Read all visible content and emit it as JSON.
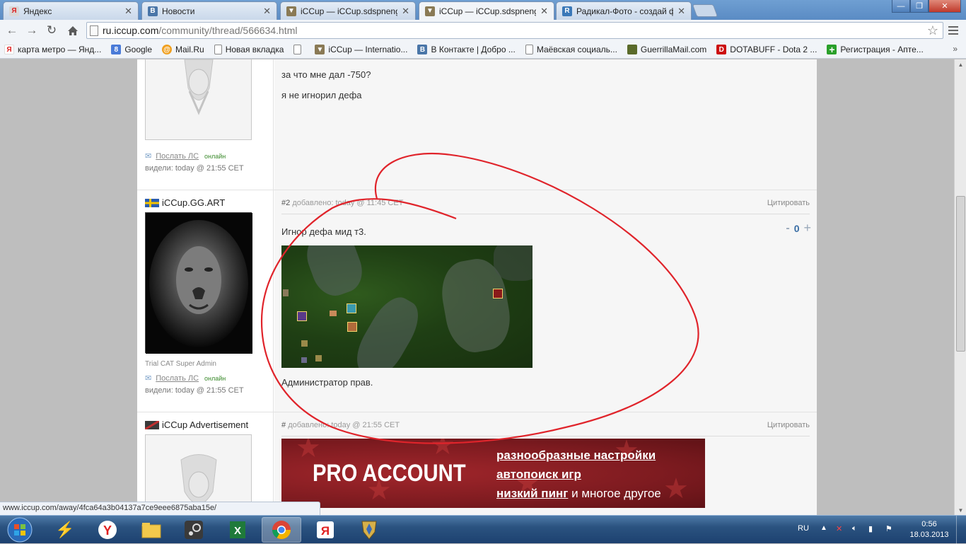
{
  "tabs": [
    {
      "label": "Яндекс",
      "color": "#d8d8d8",
      "icon": "yandex-icon",
      "glyph": "Я"
    },
    {
      "label": "Новости",
      "color": "#4a76a8",
      "icon": "vk-icon",
      "glyph": "В"
    },
    {
      "label": "iCCup — iCCup.sdspneng",
      "color": "#8a7a55",
      "icon": "iccup-icon",
      "glyph": "▼"
    },
    {
      "label": "iCCup — iCCup.sdspneng",
      "color": "#8a7a55",
      "icon": "iccup-icon",
      "glyph": "▼"
    },
    {
      "label": "Радикал-Фото - создай ф",
      "color": "#3a78b8",
      "icon": "radikal-icon",
      "glyph": "R"
    }
  ],
  "window_buttons": {
    "minimize": "—",
    "maximize": "❐",
    "close": "✕"
  },
  "address": {
    "host": "ru.iccup.com",
    "path": "/community/thread/566634.html"
  },
  "bookmarks": [
    {
      "label": "карта метро — Янд...",
      "icon": "yandex-icon",
      "color": "#d22",
      "glyph": "Я"
    },
    {
      "label": "Google",
      "icon": "google-icon",
      "color": "#4a7bd8",
      "glyph": "8"
    },
    {
      "label": "Mail.Ru",
      "icon": "mailru-icon",
      "color": "#f0a020",
      "glyph": "@"
    },
    {
      "label": "Новая вкладка",
      "icon": "page-icon",
      "color": "#ffffff",
      "glyph": ""
    },
    {
      "label": "",
      "icon": "page-icon",
      "color": "#ffffff",
      "glyph": ""
    },
    {
      "label": "iCCup — Internatio...",
      "icon": "iccup-icon",
      "color": "#8a7a55",
      "glyph": "▼"
    },
    {
      "label": "В Контакте | Добро ...",
      "icon": "vk-icon",
      "color": "#4a76a8",
      "glyph": "В"
    },
    {
      "label": "Маёвская социаль...",
      "icon": "page-icon",
      "color": "#ffffff",
      "glyph": ""
    },
    {
      "label": "GuerrillaMail.com",
      "icon": "guerrilla-icon",
      "color": "#5a6a2a",
      "glyph": ""
    },
    {
      "label": "DOTABUFF - Dota 2 ...",
      "icon": "dotabuff-icon",
      "color": "#cc1111",
      "glyph": "D"
    },
    {
      "label": "Регистрация - Апте...",
      "icon": "pharmacy-icon",
      "color": "#2aa02a",
      "glyph": "+"
    }
  ],
  "post1": {
    "line1": "за что мне дал -750?",
    "line2": "я не игнорил дефа",
    "send_pm": "Послать ЛС",
    "online": "онлайн",
    "seen": "видели: today @ 21:55 CET"
  },
  "post2": {
    "username": "iCCup.GG.ART",
    "number": "#2",
    "added": "добавлено: today @ 11:45 CET",
    "quote": "Цитировать",
    "text": "Игнор дефа мид т3.",
    "vote_minus": "-",
    "vote_value": "0",
    "vote_plus": "+",
    "footer": "Администратор прав.",
    "rank": "Trial CAT Super Admin",
    "send_pm": "Послать ЛС",
    "online": "онлайн",
    "seen": "видели: today @ 21:55 CET"
  },
  "post3": {
    "username": "iCCup Advertisement",
    "number": "#",
    "added": "добавлено: today @ 21:55 CET",
    "quote": "Цитировать",
    "ad_big": "PRO ACCOUNT",
    "ad_line1": "разнообразные настройки",
    "ad_line2": "автопоиск игр",
    "ad_line3_bold": "низкий пинг",
    "ad_line3_rest": " и многое другое"
  },
  "status_url": "www.iccup.com/away/4fca64a3b04137a7ce9eee6875aba15e/",
  "tray": {
    "lang": "RU",
    "time": "0:56",
    "date": "18.03.2013"
  },
  "taskbar": [
    "start-button",
    "network-app",
    "yandex-browser",
    "explorer",
    "steam",
    "excel",
    "chrome",
    "yandex",
    "iccup-launcher"
  ],
  "colors": {
    "annotation": "#e0242b",
    "tab_bar": "#5a8bc4",
    "ad_bg": "#8e1e24"
  }
}
